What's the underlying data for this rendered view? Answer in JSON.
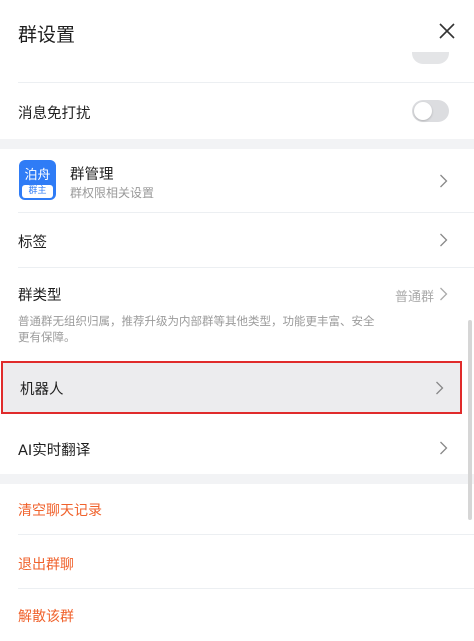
{
  "header": {
    "title": "群设置",
    "close_icon": "close-icon"
  },
  "settings": {
    "dnd_label": "消息免打扰",
    "dnd_enabled": false,
    "group_manage": {
      "avatar_top": "泊舟",
      "avatar_badge": "群主",
      "title": "群管理",
      "subtitle": "群权限相关设置"
    },
    "tags_label": "标签",
    "group_type": {
      "label": "群类型",
      "value": "普通群",
      "description": "普通群无组织归属，推荐升级为内部群等其他类型，功能更丰富、安全更有保障。"
    },
    "robot_label": "机器人",
    "ai_translate_label": "AI实时翻译"
  },
  "actions": {
    "clear_history": "清空聊天记录",
    "leave_group": "退出群聊",
    "dissolve_group": "解散该群"
  },
  "colors": {
    "danger": "#f0622c",
    "accent": "#2f7cf6",
    "highlight_border": "#e02b2b"
  }
}
